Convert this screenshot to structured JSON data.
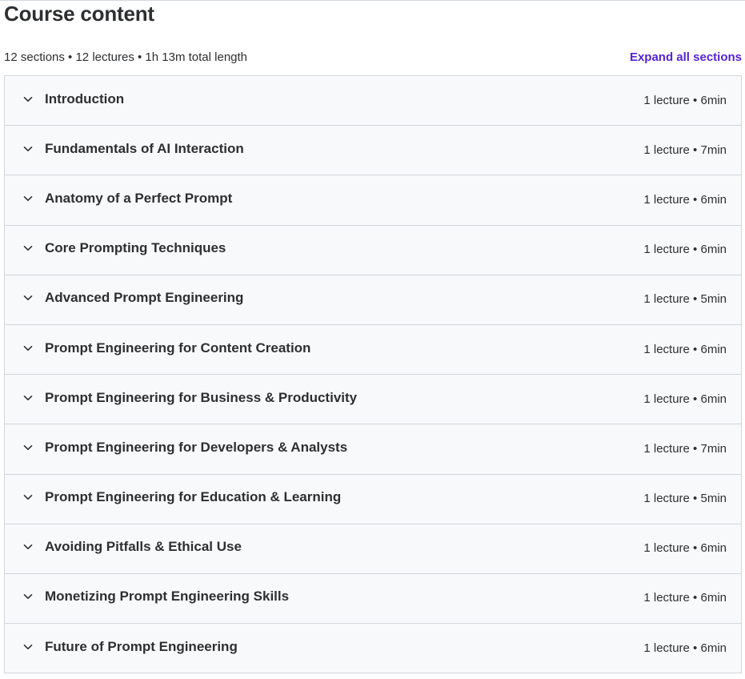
{
  "header": {
    "title": "Course content",
    "summary": "12 sections • 12 lectures • 1h 13m total length",
    "expand_all_label": "Expand all sections"
  },
  "colors": {
    "accent": "#5624d0",
    "section_bg": "#f7f9fa",
    "border": "#d1d7dc",
    "text": "#2d2f31"
  },
  "icons": {
    "section_toggle": "chevron-down-icon"
  },
  "sections": [
    {
      "title": "Introduction",
      "meta": "1 lecture • 6min"
    },
    {
      "title": "Fundamentals of AI Interaction",
      "meta": "1 lecture • 7min"
    },
    {
      "title": "Anatomy of a Perfect Prompt",
      "meta": "1 lecture • 6min"
    },
    {
      "title": "Core Prompting Techniques",
      "meta": "1 lecture • 6min"
    },
    {
      "title": "Advanced Prompt Engineering",
      "meta": "1 lecture • 5min"
    },
    {
      "title": "Prompt Engineering for Content Creation",
      "meta": "1 lecture • 6min"
    },
    {
      "title": "Prompt Engineering for Business & Productivity",
      "meta": "1 lecture • 6min"
    },
    {
      "title": "Prompt Engineering for Developers & Analysts",
      "meta": "1 lecture • 7min"
    },
    {
      "title": "Prompt Engineering for Education & Learning",
      "meta": "1 lecture • 5min"
    },
    {
      "title": "Avoiding Pitfalls & Ethical Use",
      "meta": "1 lecture • 6min"
    },
    {
      "title": "Monetizing Prompt Engineering Skills",
      "meta": "1 lecture • 6min"
    },
    {
      "title": "Future of Prompt Engineering",
      "meta": "1 lecture • 6min"
    }
  ]
}
